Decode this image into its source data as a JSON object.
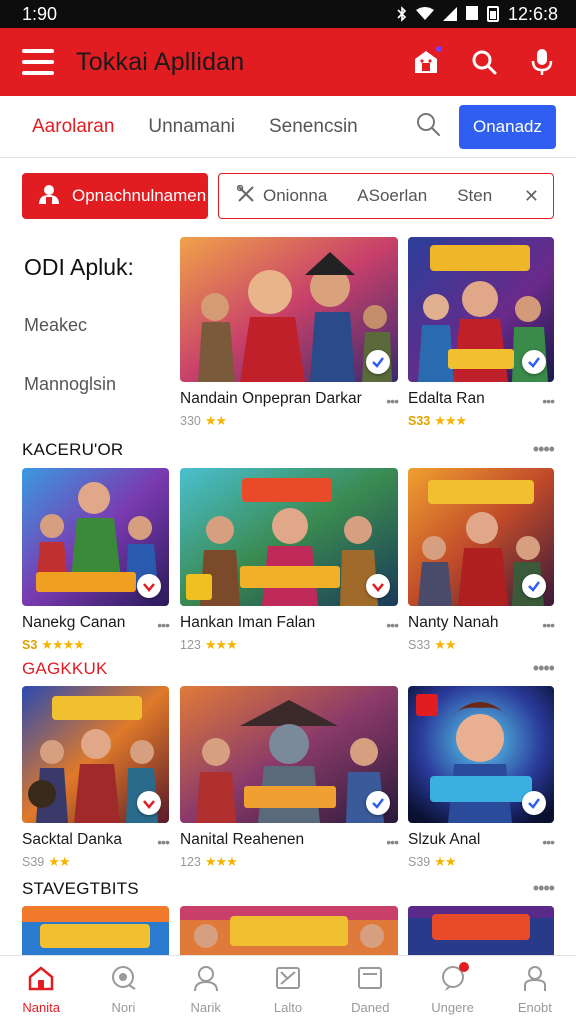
{
  "status_bar": {
    "time": "1:90",
    "clock": "12:6:8"
  },
  "app_bar": {
    "title": "Tokkai Apllidan"
  },
  "tabs": [
    {
      "label": "Aarolaran",
      "active": true
    },
    {
      "label": "Unnamani",
      "active": false
    },
    {
      "label": "Senencsin",
      "active": false
    }
  ],
  "tab_button": "Onanadz",
  "filters": {
    "primary": "Opnachnulnamen",
    "chips": [
      "Onionna",
      "ASoerlan",
      "Sten"
    ]
  },
  "side": {
    "title": "ODI Apluk:",
    "items": [
      "Meakec",
      "Mannoglsin"
    ]
  },
  "featured": [
    {
      "name": "Nandain Onpepran Darkar",
      "rating": "330",
      "stars": 2
    },
    {
      "name": "Edalta Ran",
      "rating": "S33",
      "stars": 3,
      "gold": true
    }
  ],
  "sections": [
    {
      "title": "KACERU'OR",
      "color": "dark",
      "more": "••••",
      "items": [
        {
          "name": "Nanekg Canan",
          "rating": "S3",
          "stars": 4,
          "gold": true
        },
        {
          "name": "Hankan Iman Falan",
          "rating": "123",
          "stars": 3
        },
        {
          "name": "Nanty Nanah",
          "rating": "S33",
          "stars": 2
        }
      ]
    },
    {
      "title": "GAGKKUK",
      "color": "red",
      "more": "••••",
      "items": [
        {
          "name": "Sacktal Danka",
          "rating": "S39",
          "stars": 2
        },
        {
          "name": "Nanital Reahenen",
          "rating": "123",
          "stars": 3
        },
        {
          "name": "Slzuk Anal",
          "rating": "S39",
          "stars": 2
        }
      ]
    },
    {
      "title": "STAVEGTBITS",
      "color": "dark",
      "more": "••••",
      "items": []
    }
  ],
  "bottom_nav": [
    {
      "label": "Nanita",
      "icon": "home-icon",
      "active": true
    },
    {
      "label": "Nori",
      "icon": "controller-icon",
      "active": false
    },
    {
      "label": "Narik",
      "icon": "person-icon",
      "active": false
    },
    {
      "label": "Lalto",
      "icon": "strategy-icon",
      "active": false
    },
    {
      "label": "Daned",
      "icon": "document-icon",
      "active": false
    },
    {
      "label": "Ungere",
      "icon": "chat-icon",
      "active": false,
      "dot": true
    },
    {
      "label": "Enobt",
      "icon": "profile-icon",
      "active": false
    }
  ],
  "colors": {
    "brand_red": "#e11d22",
    "accent_blue": "#2f5ef0",
    "star_gold": "#f5b400"
  }
}
